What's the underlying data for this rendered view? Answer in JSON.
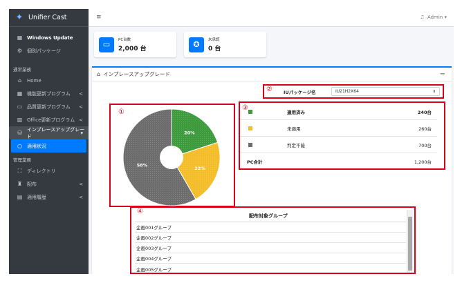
{
  "app": {
    "brand": "Unifier Cast"
  },
  "sidebar": {
    "items_top": [
      {
        "label": "Windows Update",
        "icon": "windows-icon",
        "bold": true
      },
      {
        "label": "個別パッケージ",
        "icon": "package-icon"
      }
    ],
    "section1": "通常業務",
    "items_mid": [
      {
        "label": "Home",
        "icon": "home-icon"
      },
      {
        "label": "機能更新プログラム",
        "icon": "windows-icon",
        "chev": "<"
      },
      {
        "label": "品質更新プログラム",
        "icon": "monitor-icon",
        "chev": "<"
      },
      {
        "label": "Office更新プログラム",
        "icon": "chart-icon",
        "chev": "<"
      },
      {
        "label": "インプレースアップグレード",
        "icon": "drive-icon",
        "chev": "▾"
      },
      {
        "label": "適用状況",
        "icon": "circle-icon"
      }
    ],
    "section2": "管理業務",
    "items_bottom": [
      {
        "label": "ディレクトリ",
        "icon": "sitemap-icon"
      },
      {
        "label": "配布",
        "icon": "trophy-icon",
        "chev": "<"
      },
      {
        "label": "適用履歴",
        "icon": "file-icon",
        "chev": "<"
      }
    ]
  },
  "topnav": {
    "menu_icon": "hamburger-icon",
    "user": "Admin ▾",
    "bell_icon": "bell-icon"
  },
  "info_boxes": [
    {
      "label": "PC台数",
      "value": "2,000 台",
      "icon": "laptop-icon"
    },
    {
      "label": "未承認",
      "value": "0 台",
      "icon": "award-icon"
    }
  ],
  "card": {
    "title": "インプレースアップグレード",
    "icon": "home-icon",
    "collapse": "−"
  },
  "callouts": [
    "①",
    "②",
    "③",
    "④"
  ],
  "package": {
    "label": "IUパッケージ名",
    "value": "IU21H2X64",
    "arrow": "⬍"
  },
  "chart_data": {
    "type": "pie",
    "donut": true,
    "categories": [
      "適用済み",
      "未適用",
      "判定不能"
    ],
    "values": [
      240,
      260,
      700
    ],
    "labels": [
      "20%",
      "22%",
      "58%"
    ],
    "colors": [
      "#3d9a3d",
      "#f4bd2a",
      "#6d6d6d"
    ],
    "hatched": true
  },
  "stats": {
    "rows": [
      {
        "name": "適用済み",
        "value": "240台",
        "color": "#3d9a3d",
        "bold": true
      },
      {
        "name": "未適用",
        "value": "260台",
        "color": "#f4bd2a"
      },
      {
        "name": "判定不能",
        "value": "700台",
        "color": "#6d6d6d"
      }
    ],
    "total_label": "PC合計",
    "total_value": "1,200台"
  },
  "groups": {
    "header": "配布対象グループ",
    "items": [
      "企画001グループ",
      "企画002グループ",
      "企画003グループ",
      "企画004グループ",
      "企画005グループ"
    ]
  }
}
